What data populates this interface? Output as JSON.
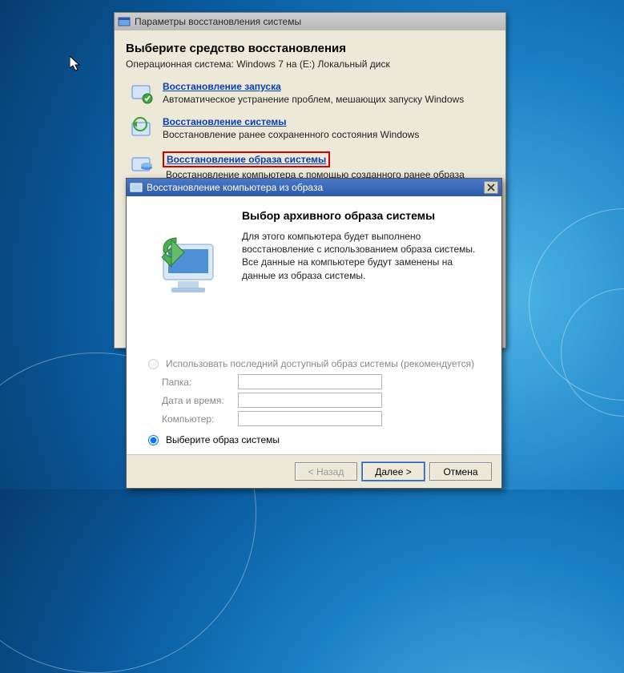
{
  "options_window": {
    "title": "Параметры восстановления системы",
    "heading": "Выберите средство восстановления",
    "os_line": "Операционная система: Windows 7 на (E:) Локальный диск",
    "items": [
      {
        "link": "Восстановление запуска",
        "desc": "Автоматическое устранение проблем, мешающих запуску Windows"
      },
      {
        "link": "Восстановление системы",
        "desc": "Восстановление ранее сохраненного состояния Windows"
      },
      {
        "link": "Восстановление образа системы",
        "desc": "Восстановление компьютера с помощью созданного ранее образа системы"
      }
    ]
  },
  "wizard": {
    "title": "Восстановление компьютера из образа",
    "heading": "Выбор архивного образа системы",
    "description": "Для этого компьютера будет выполнено восстановление с использованием образа системы. Все данные на компьютере будут заменены на данные из образа системы.",
    "radio1": "Использовать последний доступный образ системы (рекомендуется)",
    "fields": {
      "folder_label": "Папка:",
      "datetime_label": "Дата и время:",
      "computer_label": "Компьютер:",
      "folder_value": "",
      "datetime_value": "",
      "computer_value": ""
    },
    "radio2": "Выберите образ системы",
    "buttons": {
      "back": "< Назад",
      "next": "Далее >",
      "cancel": "Отмена"
    }
  }
}
